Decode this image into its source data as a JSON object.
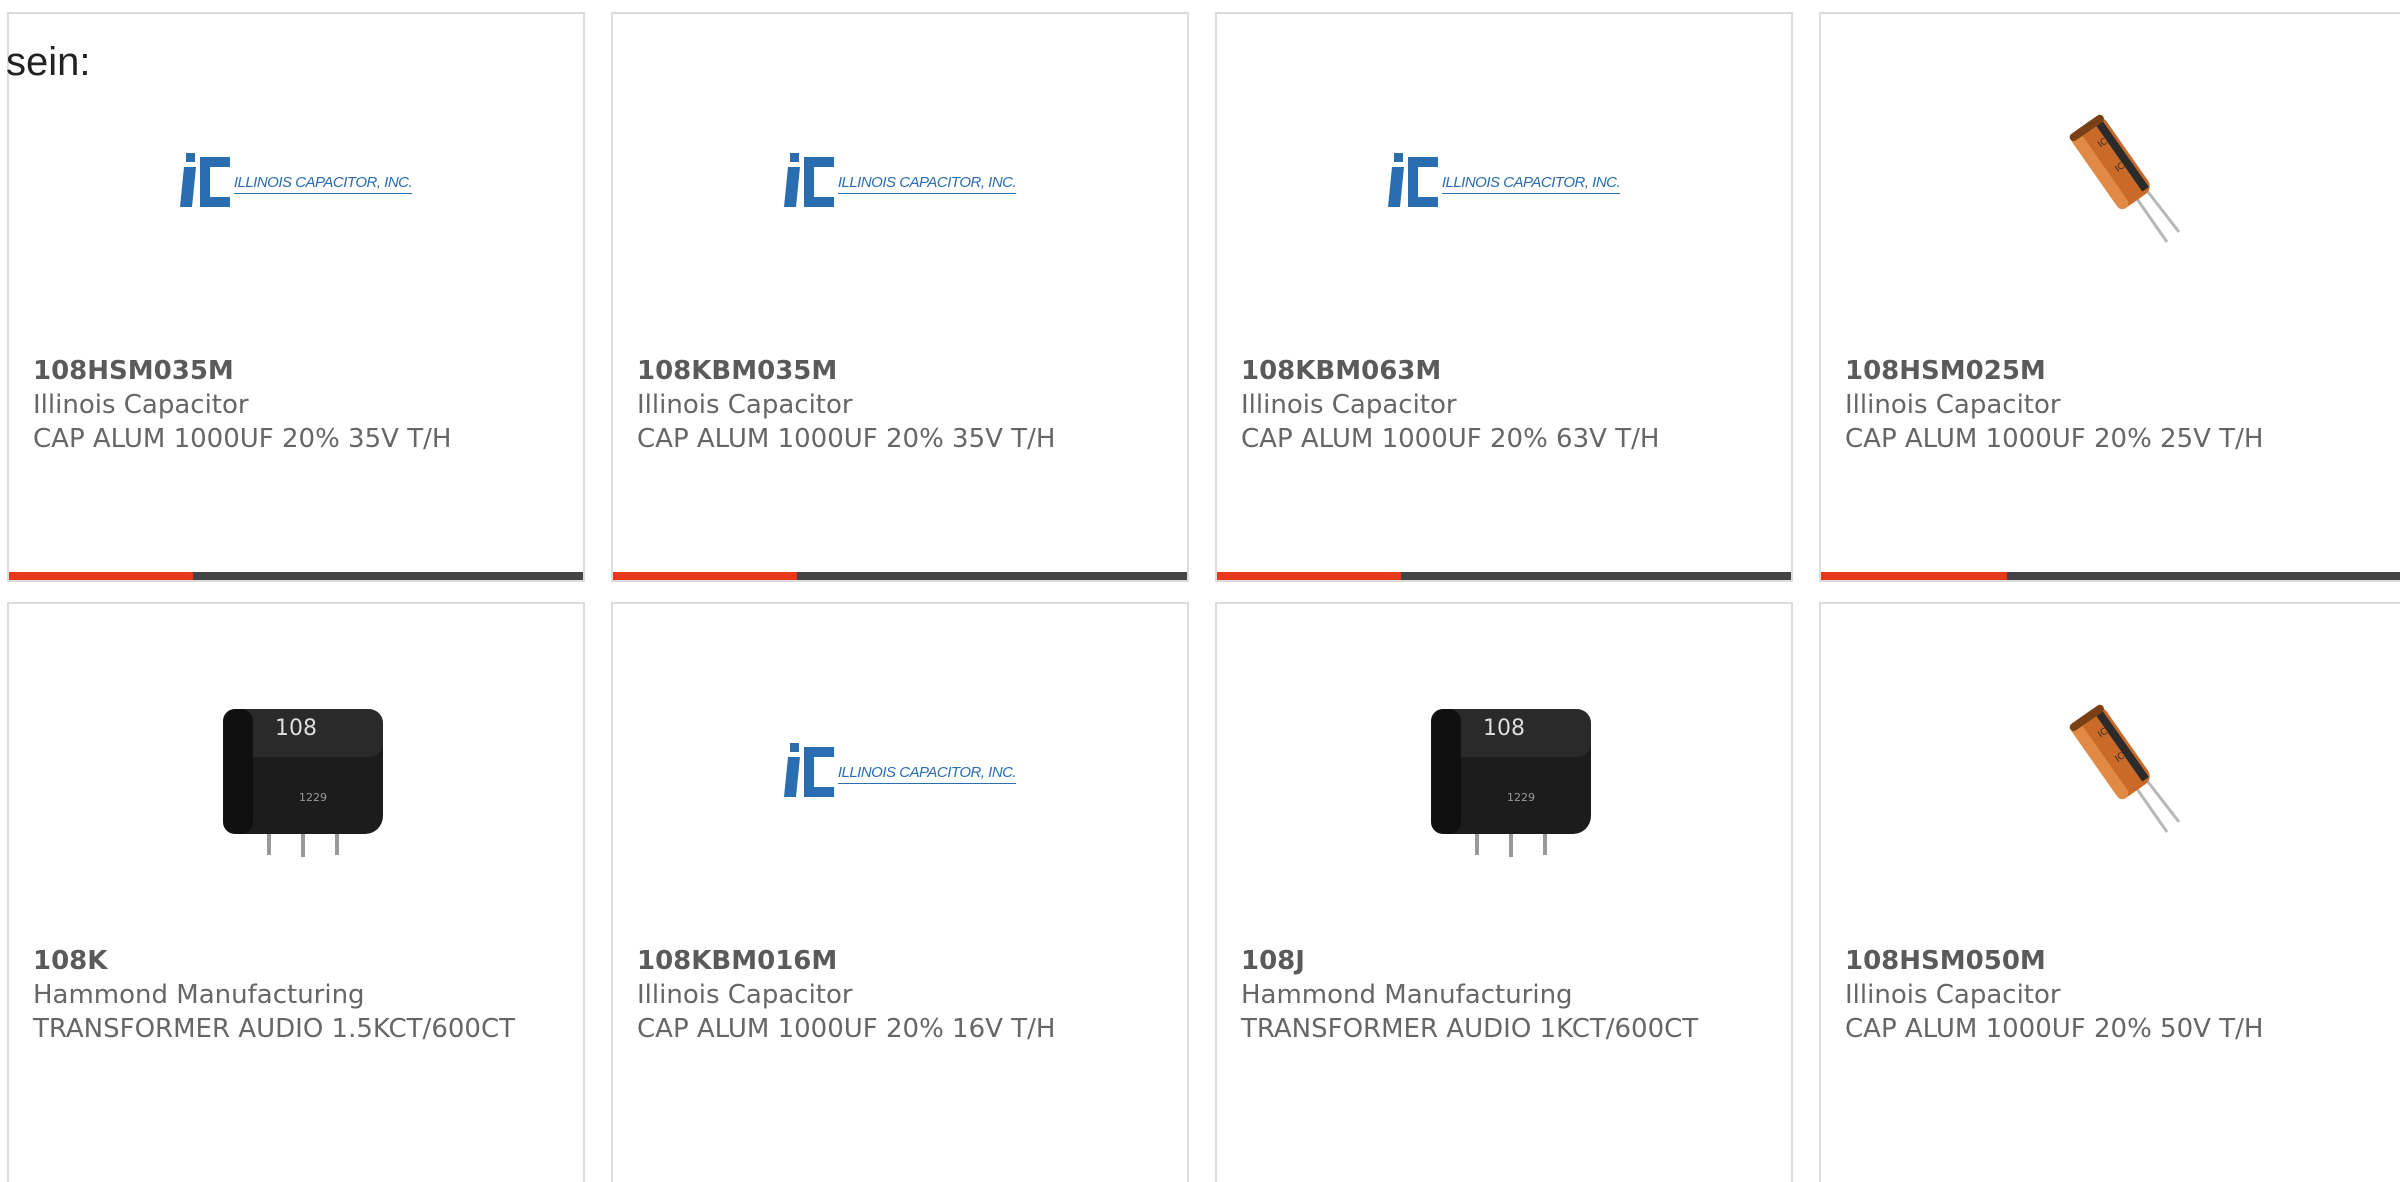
{
  "intro_text": "sein:",
  "brand_logo_text": "ILLINOIS CAPACITOR, INC.",
  "colors": {
    "progress_fill": "#e8381b",
    "progress_track": "#444444",
    "logo_blue": "#2a6db0",
    "card_border": "#dcdcdc"
  },
  "products": [
    {
      "part_number": "108HSM035M",
      "manufacturer": "Illinois Capacitor",
      "description": "CAP ALUM 1000UF 20% 35V T/H",
      "image": "illinois-capacitor-logo",
      "progress": 0.32
    },
    {
      "part_number": "108KBM035M",
      "manufacturer": "Illinois Capacitor",
      "description": "CAP ALUM 1000UF 20% 35V T/H",
      "image": "illinois-capacitor-logo",
      "progress": 0.32
    },
    {
      "part_number": "108KBM063M",
      "manufacturer": "Illinois Capacitor",
      "description": "CAP ALUM 1000UF 20% 63V T/H",
      "image": "illinois-capacitor-logo",
      "progress": 0.32
    },
    {
      "part_number": "108HSM025M",
      "manufacturer": "Illinois Capacitor",
      "description": "CAP ALUM 1000UF 20% 25V T/H",
      "image": "electrolytic-capacitor-photo",
      "progress": 0.32
    },
    {
      "part_number": "108K",
      "manufacturer": "Hammond Manufacturing",
      "description": "TRANSFORMER AUDIO 1.5KCT/600CT",
      "image": "audio-transformer-photo",
      "image_text": "108",
      "image_subtext": "1229"
    },
    {
      "part_number": "108KBM016M",
      "manufacturer": "Illinois Capacitor",
      "description": "CAP ALUM 1000UF 20% 16V T/H",
      "image": "illinois-capacitor-logo"
    },
    {
      "part_number": "108J",
      "manufacturer": "Hammond Manufacturing",
      "description": "TRANSFORMER AUDIO 1KCT/600CT",
      "image": "audio-transformer-photo",
      "image_text": "108",
      "image_subtext": "1229"
    },
    {
      "part_number": "108HSM050M",
      "manufacturer": "Illinois Capacitor",
      "description": "CAP ALUM 1000UF 20% 50V T/H",
      "image": "electrolytic-capacitor-photo"
    }
  ]
}
